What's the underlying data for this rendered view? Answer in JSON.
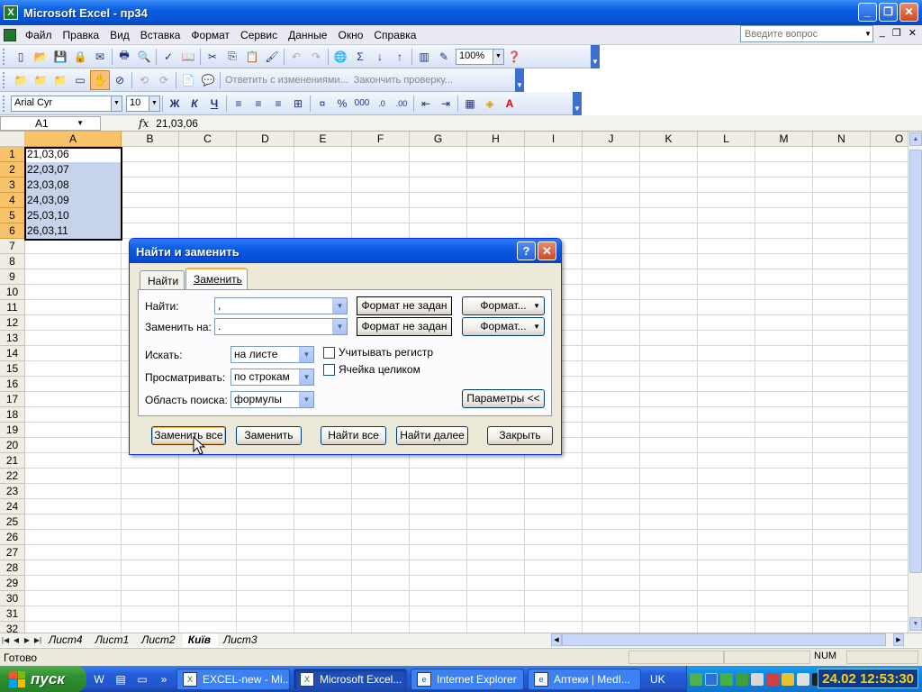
{
  "window": {
    "title": "Microsoft Excel - пр34",
    "minimize": "_",
    "restore": "❐",
    "close": "✕"
  },
  "menu": [
    "Файл",
    "Правка",
    "Вид",
    "Вставка",
    "Формат",
    "Сервис",
    "Данные",
    "Окно",
    "Справка"
  ],
  "help_search": {
    "placeholder": "Введите вопрос"
  },
  "toolbar_standard": {
    "zoom": "100%"
  },
  "toolbar_review": {
    "reply_label": "Ответить с изменениями...",
    "end_review_label": "Закончить проверку..."
  },
  "toolbar_format": {
    "font": "Arial Cyr",
    "size": "10",
    "bold": "Ж",
    "italic": "К",
    "underline": "Ч",
    "percent": "%",
    "thousands": "000"
  },
  "formula_bar": {
    "name_box": "A1",
    "fx": "fx",
    "value": "21,03,06"
  },
  "grid": {
    "columns": [
      "A",
      "B",
      "C",
      "D",
      "E",
      "F",
      "G",
      "H",
      "I",
      "J",
      "K",
      "L",
      "M",
      "N",
      "O"
    ],
    "rows": [
      "1",
      "2",
      "3",
      "4",
      "5",
      "6",
      "7",
      "8",
      "9",
      "10",
      "11",
      "12",
      "13",
      "14",
      "15",
      "16",
      "17",
      "18",
      "19",
      "20",
      "21",
      "22",
      "23",
      "24",
      "25",
      "26",
      "27",
      "28",
      "29",
      "30",
      "31",
      "32"
    ],
    "cells_A": [
      "21,03,06",
      "22,03,07",
      "23,03,08",
      "24,03,09",
      "25,03,10",
      "26,03,11"
    ]
  },
  "sheet_tabs": [
    "Лист4",
    "Лист1",
    "Лист2",
    "Київ",
    "Лист3"
  ],
  "active_sheet": "Київ",
  "status": {
    "ready": "Готово",
    "num": "NUM"
  },
  "dialog": {
    "title": "Найти и заменить",
    "help": "?",
    "close": "✕",
    "tabs": [
      "Найти",
      "Заменить"
    ],
    "find_label": "Найти:",
    "find_value": ",",
    "replace_label": "Заменить на:",
    "replace_value": ".",
    "format_not_set_1": "Формат не задан",
    "format_not_set_2": "Формат не задан",
    "format_btn_1": "Формат...",
    "format_btn_2": "Формат...",
    "within_label": "Искать:",
    "within_value": "на листе",
    "search_label": "Просматривать:",
    "search_value": "по строкам",
    "lookin_label": "Область поиска:",
    "lookin_value": "формулы",
    "match_case": "Учитывать регистр",
    "match_entire": "Ячейка целиком",
    "options_btn": "Параметры <<",
    "replace_all": "Заменить все",
    "replace": "Заменить",
    "find_all": "Найти все",
    "find_next": "Найти далее",
    "close_btn": "Закрыть"
  },
  "taskbar": {
    "start": "пуск",
    "tasks": [
      "EXCEL-new - Mi...",
      "Microsoft Excel...",
      "Internet Explorer",
      "Аптеки | MedI..."
    ],
    "lang": "UK",
    "clock": "24.02 12:53:30"
  }
}
